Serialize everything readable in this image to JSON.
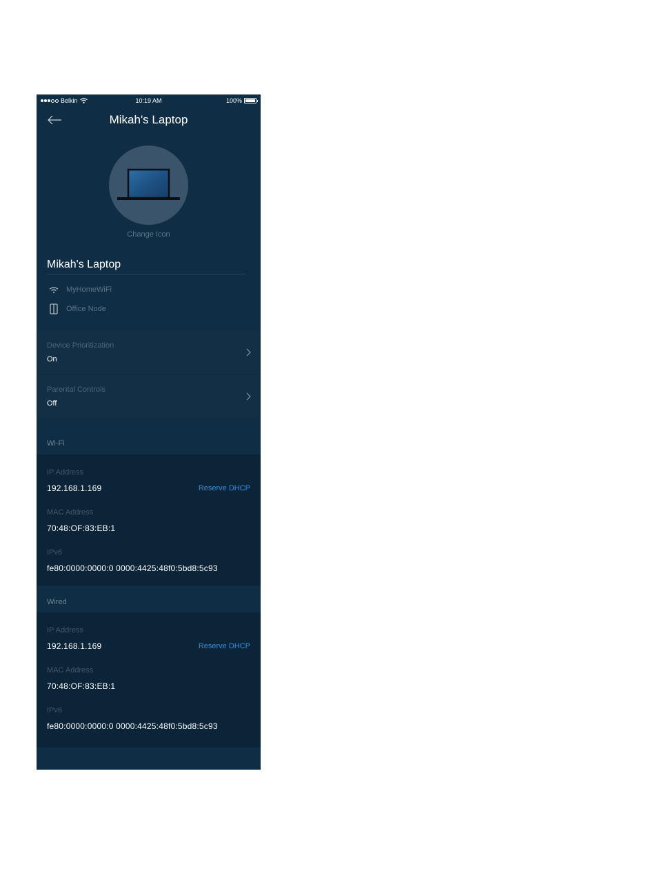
{
  "status_bar": {
    "carrier": "Belkin",
    "time": "10:19 AM",
    "battery": "100%"
  },
  "nav": {
    "title": "Mikah's Laptop"
  },
  "device": {
    "change_icon_label": "Change Icon",
    "name": "Mikah's Laptop",
    "network": "MyHomeWiFi",
    "node": "Office Node"
  },
  "settings": [
    {
      "label": "Device Prioritization",
      "value": "On"
    },
    {
      "label": "Parental Controls",
      "value": "Off"
    }
  ],
  "wifi": {
    "header": "Wi-Fi",
    "ip_label": "IP Address",
    "ip_value": "192.168.1.169",
    "reserve_label": "Reserve DHCP",
    "mac_label": "MAC Address",
    "mac_value": "70:48:OF:83:EB:1",
    "ipv6_label": "IPv6",
    "ipv6_value": "fe80:0000:0000:0 0000:4425:48f0:5bd8:5c93"
  },
  "wired": {
    "header": "Wired",
    "ip_label": "IP Address",
    "ip_value": "192.168.1.169",
    "reserve_label": "Reserve DHCP",
    "mac_label": "MAC Address",
    "mac_value": "70:48:OF:83:EB:1",
    "ipv6_label": "IPv6",
    "ipv6_value": "fe80:0000:0000:0 0000:4425:48f0:5bd8:5c93"
  },
  "colors": {
    "background": "#0f2d44",
    "accent": "#2e8fe0"
  }
}
